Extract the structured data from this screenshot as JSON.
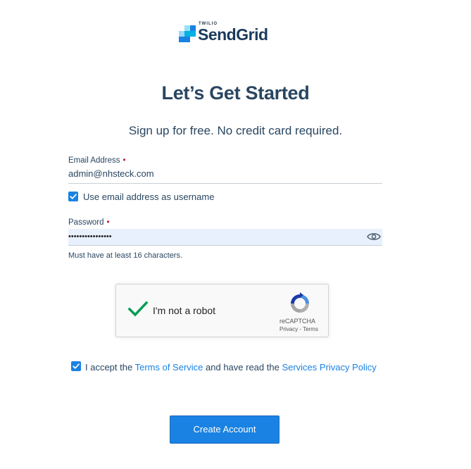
{
  "logo": {
    "overline": "TWILIO",
    "name": "SendGrid",
    "colors": {
      "dark": "#1a3a5c",
      "mid": "#1a82e2",
      "light": "#9dd6f9",
      "teal": "#00b3e3"
    }
  },
  "header": {
    "title": "Let’s Get Started",
    "subtitle": "Sign up for free. No credit card required."
  },
  "form": {
    "email": {
      "label": "Email Address",
      "required_marker": "•",
      "value": "admin@nhsteck.com"
    },
    "use_email_as_username": {
      "checked": true,
      "label": "Use email address as username"
    },
    "password": {
      "label": "Password",
      "required_marker": "•",
      "masked_value": "••••••••••••••••",
      "toggle_icon": "eye-icon",
      "hint": "Must have at least 16 characters."
    },
    "recaptcha": {
      "checked": true,
      "label": "I'm not a robot",
      "brand": "reCAPTCHA",
      "links": "Privacy - Terms"
    },
    "terms": {
      "checked": true,
      "prefix": "I accept the ",
      "terms_link": "Terms of Service",
      "middle": " and have read the ",
      "privacy_link": "Services Privacy Policy"
    },
    "submit_label": "Create Account"
  },
  "colors": {
    "primary": "#1a82e2",
    "text": "#294661",
    "required": "#c0162d",
    "autofill_bg": "#e8f0fe",
    "recaptcha_check": "#009e55"
  }
}
